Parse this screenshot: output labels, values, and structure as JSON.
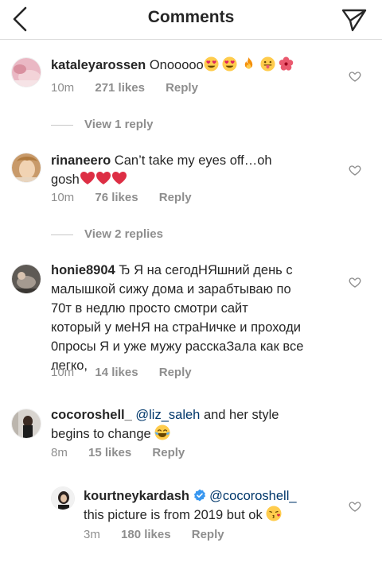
{
  "header": {
    "title": "Comments",
    "back_icon": "back-chevron-icon",
    "send_icon": "direct-send-icon"
  },
  "comments": [
    {
      "username": "kataleyarossen",
      "text": "Onooooo",
      "emojis": [
        "heart-eyes",
        "heart-eyes",
        "fire",
        "tongue-face",
        "hibiscus"
      ],
      "time": "10m",
      "likes": "271 likes",
      "reply": "Reply",
      "view_replies": "View 1 reply"
    },
    {
      "username": "rinaneero",
      "text_line1": "Can’t take my eyes off…oh",
      "text_line2": "gosh",
      "emojis": [
        "red-heart",
        "red-heart",
        "red-heart"
      ],
      "time": "10m",
      "likes": "76 likes",
      "reply": "Reply",
      "view_replies": "View 2 replies"
    },
    {
      "username": "honie8904",
      "lines": [
        "Ђ Я на сегодНЯшний день с",
        "малышкой сижу дома и зарабтываю по",
        "70т в недлю просто смотри сайт",
        "который у меНЯ на страНичке и проходи",
        "0просы Я и уже мужу расскаЗала как все",
        "легко,"
      ],
      "time": "10m",
      "likes": "14 likes",
      "reply": "Reply"
    },
    {
      "username": "cocoroshell_",
      "mention": "@liz_saleh",
      "text_after_mention": "and her style",
      "text_line2": "begins to change",
      "emojis": [
        "tears-of-joy"
      ],
      "time": "8m",
      "likes": "15 likes",
      "reply": "Reply"
    },
    {
      "username": "kourtneykardash",
      "verified": true,
      "mention": "@cocoroshell_",
      "text_line2": "this picture is from 2019 but ok",
      "emojis": [
        "kissing-heart"
      ],
      "time": "3m",
      "likes": "180 likes",
      "reply": "Reply"
    }
  ],
  "colors": {
    "text": "#262626",
    "meta": "#8e8e8e",
    "mention": "#00376b",
    "verified": "#3897f0",
    "heart_emoji": "#e0245e",
    "divider": "#dbdbdb"
  }
}
